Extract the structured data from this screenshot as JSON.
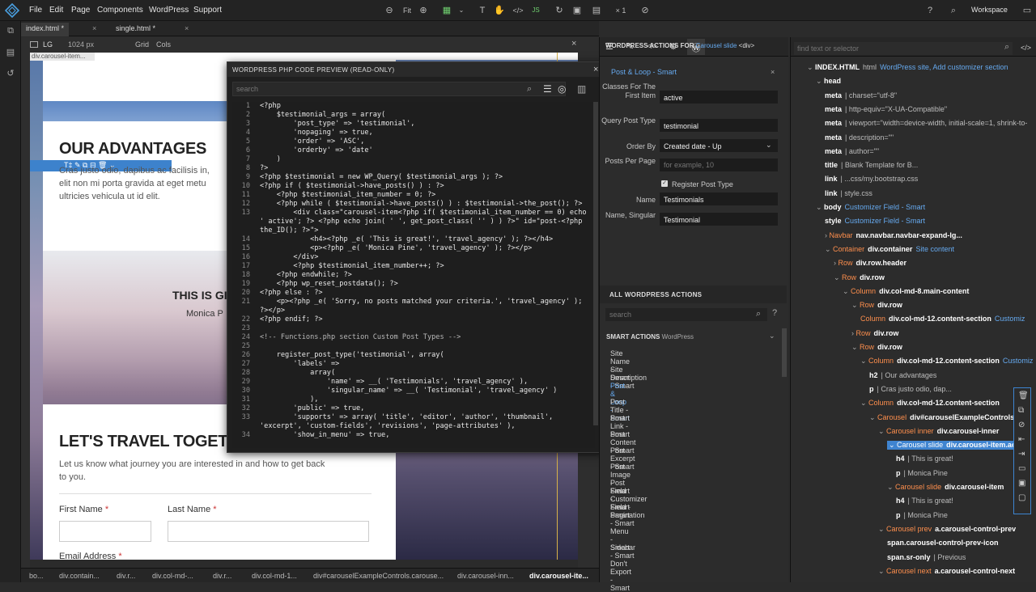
{
  "menu": [
    "File",
    "Edit",
    "Page",
    "Components",
    "WordPress",
    "Support"
  ],
  "toolbar": {
    "fit": "Fit",
    "zoom": "× 1",
    "workspace": "Workspace"
  },
  "tabs": [
    "index.html *",
    "single.html *"
  ],
  "devbar": {
    "device": "LG",
    "width": "1024 px",
    "grid": "Grid",
    "cols": "Cols",
    "breadcrumb_label": "div.carousel-item..."
  },
  "page": {
    "advantages_title": "OUR ADVANTAGES",
    "advantages_text1": "Cras justo odio, dapibus ac facilisis in,",
    "advantages_text2": "elit non mi porta gravida at eget metu",
    "advantages_text3": "ultricies vehicula ut id elit.",
    "slide_title": "THIS IS GI",
    "slide_sub": "Monica P",
    "travel_title": "LET'S TRAVEL TOGETH",
    "travel_text1": "Let us know what journey you are interested in and how to get back",
    "travel_text2": "to you.",
    "first_name": "First Name",
    "last_name": "Last Name",
    "email": "Email Address",
    "required": "*"
  },
  "code_panel": {
    "title": "WORDPRESS PHP CODE PREVIEW (READ-ONLY)",
    "search_placeholder": "search",
    "lines": [
      [
        "1",
        "<?php"
      ],
      [
        "2",
        "    $testimonial_args = array("
      ],
      [
        "3",
        "        'post_type' => 'testimonial',"
      ],
      [
        "4",
        "        'nopaging' => true,"
      ],
      [
        "5",
        "        'order' => 'ASC',"
      ],
      [
        "6",
        "        'orderby' => 'date'"
      ],
      [
        "7",
        "    )"
      ],
      [
        "8",
        "?>"
      ],
      [
        "9",
        "<?php $testimonial = new WP_Query( $testimonial_args ); ?>"
      ],
      [
        "10",
        "<?php if ( $testimonial->have_posts() ) : ?>"
      ],
      [
        "11",
        "    <?php $testimonial_item_number = 0; ?>"
      ],
      [
        "12",
        "    <?php while ( $testimonial->have_posts() ) : $testimonial->the_post(); ?>"
      ],
      [
        "13",
        "        <div class=\"carousel-item<?php if( $testimonial_item_number == 0) echo"
      ],
      [
        "",
        "' active'; ?> <?php echo join( ' ', get_post_class( '' ) ) ?>\" id=\"post-<?php"
      ],
      [
        "",
        "the_ID(); ?>\">"
      ],
      [
        "14",
        "            <h4><?php _e( 'This is great!', 'travel_agency' ); ?></h4>"
      ],
      [
        "15",
        "            <p><?php _e( 'Monica Pine', 'travel_agency' ); ?></p>"
      ],
      [
        "16",
        "        </div>"
      ],
      [
        "17",
        "        <?php $testimonial_item_number++; ?>"
      ],
      [
        "18",
        "    <?php endwhile; ?>"
      ],
      [
        "19",
        "    <?php wp_reset_postdata(); ?>"
      ],
      [
        "20",
        "<?php else : ?>"
      ],
      [
        "21",
        "    <p><?php _e( 'Sorry, no posts matched your criteria.', 'travel_agency' );"
      ],
      [
        "",
        "?></p>"
      ],
      [
        "22",
        "<?php endif; ?>"
      ],
      [
        "23",
        ""
      ],
      [
        "24",
        "<!-- Functions.php section Custom Post Types -->"
      ],
      [
        "25",
        ""
      ],
      [
        "26",
        "    register_post_type('testimonial', array("
      ],
      [
        "27",
        "        'labels' =>"
      ],
      [
        "28",
        "            array("
      ],
      [
        "29",
        "                'name' => __( 'Testimonials', 'travel_agency' ),"
      ],
      [
        "30",
        "                'singular_name' => __( 'Testimonial', 'travel_agency' )"
      ],
      [
        "31",
        "            ),"
      ],
      [
        "32",
        "        'public' => true,"
      ],
      [
        "33",
        "        'supports' => array( 'title', 'editor', 'author', 'thumbnail',"
      ],
      [
        "",
        "'excerpt', 'custom-fields', 'revisions', 'page-attributes' ),"
      ],
      [
        "34",
        "        'show_in_menu' => true,"
      ]
    ]
  },
  "wp_actions": {
    "header_prefix": "WORDPRESS ACTIONS FOR",
    "header_element": "Carousel slide",
    "header_tag": "<div>",
    "section": "Post & Loop - Smart",
    "fields": [
      {
        "label": "Classes For The First Item",
        "value": "active",
        "placeholder": ""
      },
      {
        "label": "Query Post Type",
        "value": "testimonial",
        "placeholder": ""
      },
      {
        "label": "Order By",
        "value": "Created date - Up",
        "placeholder": ""
      },
      {
        "label": "Posts Per Page",
        "value": "",
        "placeholder": "for example, 10"
      },
      {
        "label": "Name",
        "value": "Testimonials",
        "placeholder": ""
      },
      {
        "label": "Name, Singular",
        "value": "Testimonial",
        "placeholder": ""
      }
    ],
    "register_label": "Register Post Type",
    "all_title": "ALL WORDPRESS ACTIONS",
    "search_placeholder": "search",
    "smart_title": "SMART ACTIONS",
    "smart_sub": "WordPress",
    "items": [
      "Site Name - Smart",
      "Site Description - Smart",
      "Post & Loop - Smart",
      "Post Title - Smart",
      "Post Link - Smart",
      "Post Content - Smart",
      "Post Excerpt - Smart",
      "Post Image - Smart",
      "Post Field - Smart",
      "Customizer Field - Smart",
      "Pagination - Smart",
      "Menu - Smart",
      "Sidebar - Smart",
      "Don't Export - Smart"
    ]
  },
  "tree": {
    "search_placeholder": "find text or selector",
    "nodes": [
      {
        "t": "INDEX.HTML",
        "d": "html",
        "s": "WordPress site, Add customizer section",
        "o": ""
      },
      {
        "t": "head",
        "d": "",
        "s": "",
        "o": ""
      },
      {
        "t": "meta",
        "d": "| charset=\"utf-8\"",
        "s": "",
        "o": ""
      },
      {
        "t": "meta",
        "d": "| http-equiv=\"X-UA-Compatible\"",
        "s": "",
        "o": ""
      },
      {
        "t": "meta",
        "d": "| viewport=\"width=device-width, initial-scale=1, shrink-to-",
        "s": "",
        "o": ""
      },
      {
        "t": "meta",
        "d": "| description=\"\"",
        "s": "",
        "o": ""
      },
      {
        "t": "meta",
        "d": "| author=\"\"",
        "s": "",
        "o": ""
      },
      {
        "t": "title",
        "d": "| Blank Template for B...",
        "s": "",
        "o": ""
      },
      {
        "t": "link",
        "d": "| ...css/my.bootstrap.css",
        "s": "",
        "o": ""
      },
      {
        "t": "link",
        "d": "| style.css",
        "s": "",
        "o": ""
      },
      {
        "t": "body",
        "d": "",
        "s": "Customizer Field - Smart",
        "o": ""
      },
      {
        "t": "style",
        "d": "",
        "s": "Customizer Field - Smart",
        "o": ""
      },
      {
        "t": "nav.navbar.navbar-expand-lg...",
        "d": "",
        "s": "",
        "o": "Navbar"
      },
      {
        "t": "div.container",
        "d": "",
        "s": "Site content",
        "o": "Container"
      },
      {
        "t": "div.row.header",
        "d": "",
        "s": "",
        "o": "Row"
      },
      {
        "t": "div.row",
        "d": "",
        "s": "",
        "o": "Row"
      },
      {
        "t": "div.col-md-8.main-content",
        "d": "",
        "s": "",
        "o": "Column"
      },
      {
        "t": "div.row",
        "d": "",
        "s": "",
        "o": "Row"
      },
      {
        "t": "div.col-md-12.content-section",
        "d": "",
        "s": "Customiz",
        "o": "Column"
      },
      {
        "t": "div.row",
        "d": "",
        "s": "",
        "o": "Row"
      },
      {
        "t": "div.row",
        "d": "",
        "s": "",
        "o": "Row"
      },
      {
        "t": "div.col-md-12.content-section",
        "d": "",
        "s": "Customiz",
        "o": "Column"
      },
      {
        "t": "h2",
        "d": "| Our advantages",
        "s": "",
        "o": ""
      },
      {
        "t": "p",
        "d": "| Cras justo odio, dap...",
        "s": "",
        "o": ""
      },
      {
        "t": "div.col-md-12.content-section",
        "d": "",
        "s": "",
        "o": "Column"
      },
      {
        "t": "div#carouselExampleControls.car",
        "d": "",
        "s": "",
        "o": "Carousel"
      },
      {
        "t": "div.carousel-inner",
        "d": "",
        "s": "",
        "o": "Carousel inner"
      },
      {
        "t": "div.carousel-item.activ",
        "d": "",
        "s": "",
        "o": "Carousel slide"
      },
      {
        "t": "h4",
        "d": "| This is great!",
        "s": "",
        "o": ""
      },
      {
        "t": "p",
        "d": "| Monica Pine",
        "s": "",
        "o": ""
      },
      {
        "t": "div.carousel-item",
        "d": "",
        "s": "",
        "o": "Carousel slide"
      },
      {
        "t": "h4",
        "d": "| This is great!",
        "s": "",
        "o": ""
      },
      {
        "t": "p",
        "d": "| Monica Pine",
        "s": "",
        "o": ""
      },
      {
        "t": "a.carousel-control-prev",
        "d": "",
        "s": "",
        "o": "Carousel prev"
      },
      {
        "t": "span.carousel-control-prev-icon",
        "d": "",
        "s": "",
        "o": ""
      },
      {
        "t": "span.sr-only",
        "d": "| Previous",
        "s": "",
        "o": ""
      },
      {
        "t": "a.carousel-control-next",
        "d": "",
        "s": "",
        "o": "Carousel next"
      }
    ]
  },
  "breadcrumbs": [
    "bo...",
    "div.contain...",
    "div.r...",
    "div.col-md-...",
    "div.r...",
    "div.col-md-1...",
    "div#carouselExampleControls.carouse...",
    "div.carousel-inn...",
    "div.carousel-ite..."
  ]
}
